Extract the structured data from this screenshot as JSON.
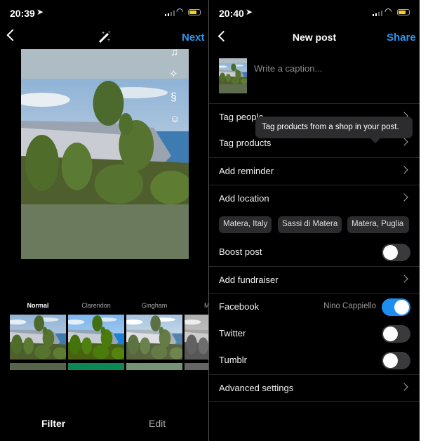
{
  "left": {
    "status": {
      "time": "20:39"
    },
    "header": {
      "next_label": "Next",
      "magic_icon": "magic-wand-icon"
    },
    "side_icons": [
      "music-icon",
      "sparkles-icon",
      "squiggle-icon",
      "tag-person-icon"
    ],
    "filters": [
      {
        "label": "Normal",
        "selected": true
      },
      {
        "label": "Clarendon"
      },
      {
        "label": "Gingham"
      },
      {
        "label": "M"
      }
    ],
    "bottom_tabs": {
      "filter": "Filter",
      "edit": "Edit"
    }
  },
  "right": {
    "status": {
      "time": "20:40"
    },
    "header": {
      "title": "New post",
      "share_label": "Share"
    },
    "caption_placeholder": "Write a caption...",
    "tooltip": "Tag products from a shop in your post.",
    "rows": [
      {
        "label": "Tag people"
      },
      {
        "label": "Tag products"
      },
      {
        "label": "Add reminder"
      },
      {
        "label": "Add location"
      }
    ],
    "location_chips": [
      "Matera, Italy",
      "Sassi di Matera",
      "Matera, Puglia"
    ],
    "boost_post": {
      "label": "Boost post",
      "on": false
    },
    "add_fundraiser": "Add fundraiser",
    "facebook": {
      "label": "Facebook",
      "account": "Nino Cappiello",
      "on": true
    },
    "twitter": {
      "label": "Twitter",
      "on": false
    },
    "tumblr": {
      "label": "Tumblr",
      "on": false
    },
    "advanced": "Advanced settings"
  },
  "colors": {
    "accent": "#2d95e8",
    "toggle_on": "#1d8ef0",
    "battery": "#f5d020"
  }
}
